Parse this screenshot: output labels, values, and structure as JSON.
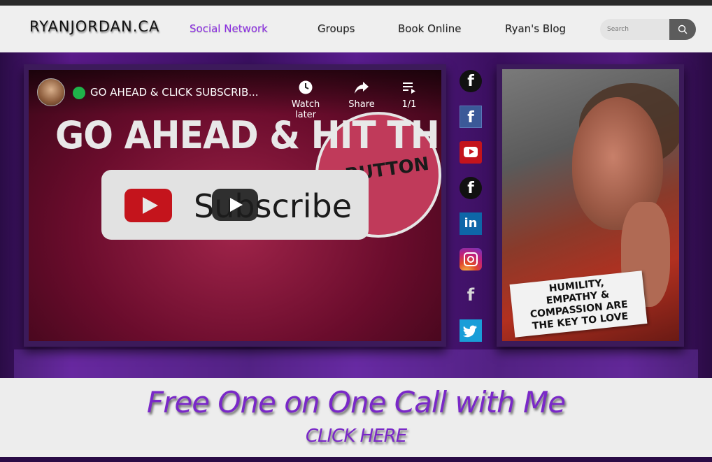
{
  "site": {
    "logo": "RYANJORDAN.CA"
  },
  "nav": {
    "items": [
      {
        "label": "Social Network",
        "active": true
      },
      {
        "label": "Groups",
        "active": false
      },
      {
        "label": "Book Online",
        "active": false
      },
      {
        "label": "Ryan's Blog",
        "active": false
      }
    ],
    "active_color": "#8a2be2"
  },
  "search": {
    "placeholder": "Search",
    "icon": "search-icon"
  },
  "video": {
    "title": "GO AHEAD & CLICK SUBSCRIB...",
    "headline": "GO AHEAD & HIT THE",
    "button_word": "BUTTON",
    "subscribe_word": "Subscribe",
    "watch_later_label": "Watch later",
    "share_label": "Share",
    "playlist_count": "1/1"
  },
  "social_icons": [
    {
      "name": "facebook-circle-icon",
      "glyph": "f"
    },
    {
      "name": "facebook-square-icon",
      "glyph": "f"
    },
    {
      "name": "youtube-icon"
    },
    {
      "name": "facebook-circle-icon",
      "glyph": "f"
    },
    {
      "name": "linkedin-icon",
      "glyph": "in"
    },
    {
      "name": "instagram-icon"
    },
    {
      "name": "facebook-plain-icon",
      "glyph": "f"
    },
    {
      "name": "twitter-icon"
    }
  ],
  "photo": {
    "caption_lines": [
      "HUMILITY,",
      "EMPATHY &",
      "COMPASSION ARE",
      "THE KEY TO LOVE"
    ]
  },
  "promo": {
    "title": "Free One on One Call with Me",
    "cta": "CLICK HERE",
    "color": "#7a28c8"
  }
}
